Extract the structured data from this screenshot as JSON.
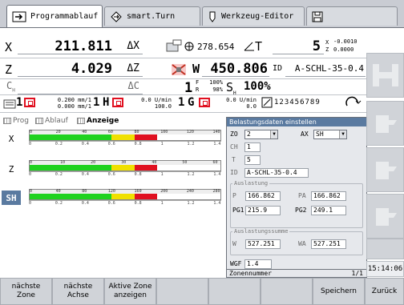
{
  "tabs": [
    {
      "label": "Programmablauf"
    },
    {
      "label": "smart.Turn"
    },
    {
      "label": "Werkzeug-Editor"
    },
    {
      "label": ""
    }
  ],
  "axes": {
    "x": {
      "label": "X",
      "value": "211.811",
      "dist_label": "ΔX"
    },
    "z": {
      "label": "Z",
      "value": "4.029",
      "dist_label": "ΔZ"
    },
    "c": {
      "label": "C",
      "sub": "H",
      "dist_label": "ΔC"
    }
  },
  "tool": {
    "angle": "278.654",
    "t_label": "T",
    "t_value": "5",
    "x_corr": "-0.0010",
    "z_corr": "0.0000",
    "x_corr_label": "X",
    "z_corr_label": "Z",
    "w_label": "W",
    "w_value": "450.806",
    "id_label": "ID",
    "id_value": "A-SCHL-35-0.4"
  },
  "spindle": {
    "num": "1",
    "f_label": "F",
    "f_val": "100%",
    "r_label": "R",
    "r_val": "98%",
    "s_label": "S",
    "s_sub": "H",
    "s_val": "100%"
  },
  "feed": {
    "ch_num": "1",
    "feed1": "0.200 mm/1",
    "feed2": "0.000 mm/1",
    "h_num": "1",
    "h_label": "H",
    "h_val1": "0.0 U/min",
    "h_val2": "100.0",
    "g_num": "1",
    "g_label": "G",
    "g_val1": "0.0 U/min",
    "g_val2": "0.0",
    "digits": "123456789"
  },
  "view": {
    "prog": "Prog",
    "ablauf": "Ablauf",
    "anzeige": "Anzeige"
  },
  "load_bars": [
    {
      "label": "X",
      "top_ticks": [
        "0",
        "20",
        "40",
        "60",
        "80",
        "100",
        "120",
        "140"
      ],
      "bottom_ticks": [
        "0",
        "0.2",
        "0.4",
        "0.6",
        "0.8",
        "1",
        "1.2",
        "1.4"
      ]
    },
    {
      "label": "Z",
      "top_ticks": [
        "0",
        "10",
        "20",
        "30",
        "40",
        "50",
        "60"
      ],
      "bottom_ticks": [
        "0",
        "0.2",
        "0.4",
        "0.6",
        "0.8",
        "1",
        "1.2",
        "1.4"
      ]
    },
    {
      "label": "SH",
      "top_ticks": [
        "0",
        "40",
        "80",
        "120",
        "160",
        "200",
        "240",
        "280"
      ],
      "bottom_ticks": [
        "0",
        "0.2",
        "0.4",
        "0.6",
        "0.8",
        "1",
        "1.2",
        "1.4"
      ]
    }
  ],
  "dialog": {
    "title": "Belastungsdaten einstellen",
    "zo_label": "ZO",
    "zo_value": "2",
    "ax_label": "AX",
    "ax_value": "SH",
    "ch_label": "CH",
    "ch_value": "1",
    "t_label": "T",
    "t_value": "5",
    "id_label": "ID",
    "id_value": "A-SCHL-35-0.4",
    "auslastung": "Auslastung",
    "p_label": "P",
    "p_value": "166.862",
    "pa_label": "PA",
    "pa_value": "166.862",
    "pg1_label": "PG1",
    "pg1_value": "215.9",
    "pg2_label": "PG2",
    "pg2_value": "249.1",
    "summe": "Auslastungssumme",
    "w_label": "W",
    "w_value": "527.251",
    "wa_label": "WA",
    "wa_value": "527.251",
    "wgf_label": "WGF",
    "wgf_value": "1.4",
    "footer": "Zonennummer",
    "page": "1/1"
  },
  "clock": "15:14:06",
  "softkeys": {
    "naechste_zone": "nächste\nZone",
    "naechste_achse": "nächste\nAchse",
    "aktive_zone": "Aktive Zone\nanzeigen",
    "speichern": "Speichern",
    "zurueck": "Zurück"
  },
  "colors": {
    "green": "#1fd21f",
    "yellow": "#f0e000",
    "red": "#e01020",
    "accent": "#5a7aa0"
  }
}
